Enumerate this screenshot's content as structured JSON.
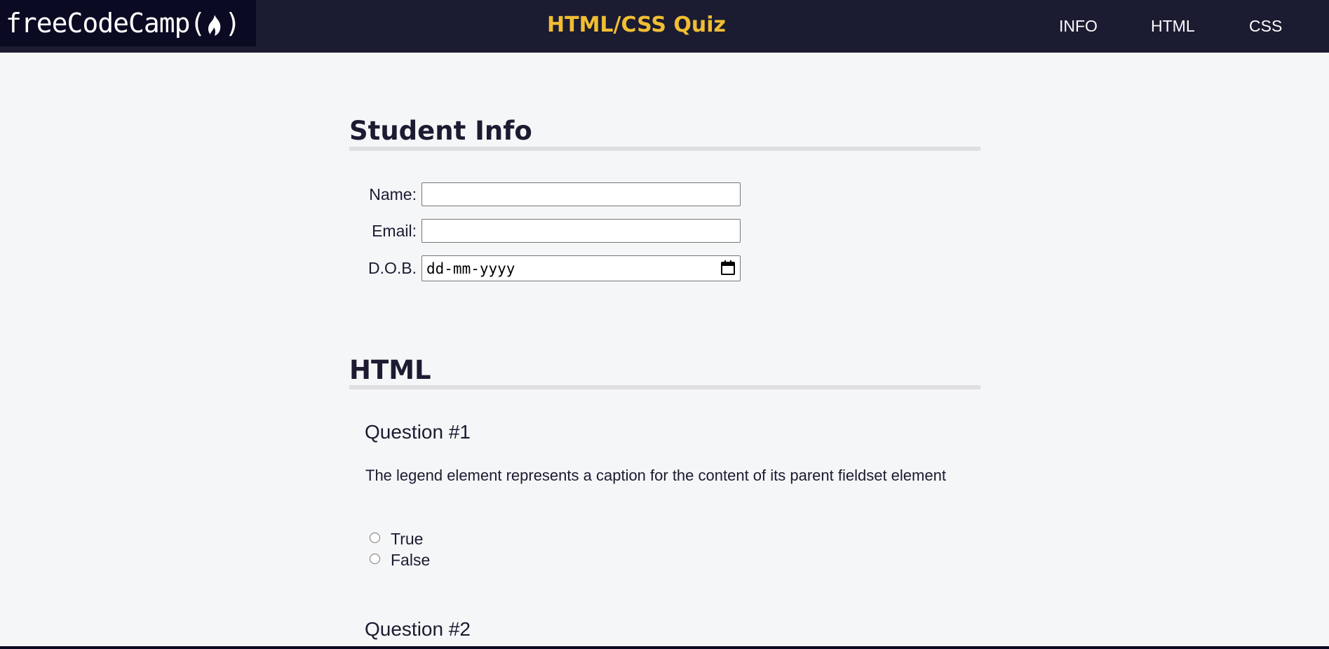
{
  "header": {
    "logo_text_prefix": "freeCodeCamp(",
    "logo_text_suffix": ")",
    "logo_icon": "flame-icon",
    "title": "HTML/CSS Quiz",
    "nav": [
      "INFO",
      "HTML",
      "CSS"
    ]
  },
  "student_info": {
    "heading": "Student Info",
    "name_label": "Name:",
    "email_label": "Email:",
    "dob_label": "D.O.B.",
    "name_value": "",
    "email_value": "",
    "dob_placeholder": "dd-mm-yyyy",
    "calendar_icon": "calendar-icon"
  },
  "html_section": {
    "heading": "HTML",
    "questions": [
      {
        "title": "Question #1",
        "text": "The legend element represents a caption for the content of its parent fieldset element",
        "options": [
          "True",
          "False"
        ]
      },
      {
        "title": "Question #2"
      }
    ]
  },
  "colors": {
    "nav_bg": "#1b1b32",
    "logo_bg": "#0a0a23",
    "title": "#f1be32",
    "page_bg": "#f5f6f7",
    "rule": "#dfdfe2"
  }
}
